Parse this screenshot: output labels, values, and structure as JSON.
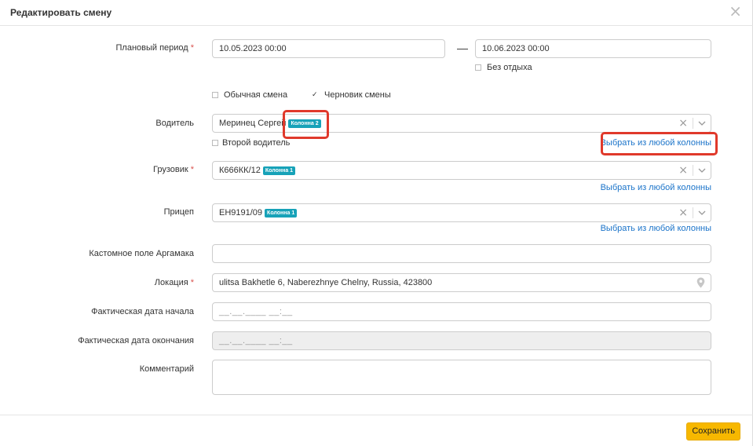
{
  "dialog": {
    "title": "Редактировать смену",
    "close_symbol": "×"
  },
  "period": {
    "label": "Плановый период",
    "required_mark": "*",
    "start_value": "10.05.2023 00:00",
    "separator": "—",
    "end_value": "10.06.2023 00:00",
    "no_rest_label": "Без отдыха",
    "no_rest_checked": false
  },
  "shift_type": {
    "regular_label": "Обычная смена",
    "regular_checked": false,
    "draft_label": "Черновик смены",
    "draft_checked": true,
    "check_symbol": "✓"
  },
  "driver": {
    "label": "Водитель",
    "value": "Меринец Сергей",
    "badge": "Колонна 2",
    "second_driver_label": "Второй водитель",
    "second_driver_checked": false,
    "choose_link": "Выбрать из любой колонны"
  },
  "truck": {
    "label": "Грузовик",
    "required_mark": "*",
    "value": "К666КК/12",
    "badge": "Колонна 1",
    "choose_link": "Выбрать из любой колонны"
  },
  "trailer": {
    "label": "Прицеп",
    "value": "ЕН9191/09",
    "badge": "Колонна 1",
    "choose_link": "Выбрать из любой колонны"
  },
  "custom_field": {
    "label": "Кастомное поле Аргамака",
    "value": ""
  },
  "location": {
    "label": "Локация",
    "required_mark": "*",
    "value": "ulitsa Bakhetle 6, Naberezhnye Chelny, Russia, 423800",
    "icon": "map-pin-icon"
  },
  "actual_start": {
    "label": "Фактическая дата начала",
    "placeholder": "__.__.____ __:__"
  },
  "actual_end": {
    "label": "Фактическая дата окончания",
    "placeholder": "__.__.____ __:__"
  },
  "comment": {
    "label": "Комментарий",
    "value": ""
  },
  "footer": {
    "save_label": "Сохранить"
  },
  "colors": {
    "badge": "#17a2b8",
    "link": "#1a73c9",
    "required": "#d9534f",
    "save_button": "#f7b800",
    "highlight": "#e0392b"
  }
}
